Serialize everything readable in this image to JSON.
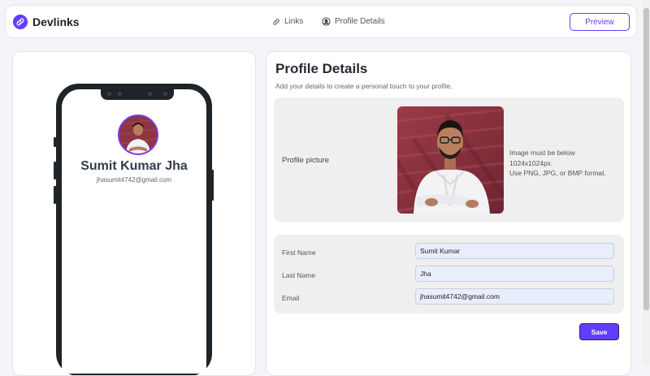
{
  "header": {
    "brand": "Devlinks",
    "tabs": [
      {
        "label": "Links",
        "icon": "link-icon"
      },
      {
        "label": "Profile Details",
        "icon": "user-circle-icon"
      }
    ],
    "preview_label": "Preview"
  },
  "preview": {
    "name": "Sumit Kumar Jha",
    "email": "jhasumit4742@gmail.com"
  },
  "profile": {
    "title": "Profile Details",
    "subtitle": "Add your details to create a personal touch to your profile.",
    "picture_label": "Profile picture",
    "picture_note": "Image must be below\n1024x1024px.\nUse PNG, JPG, or BMP format.",
    "fields": [
      {
        "label": "First Name",
        "value": "Sumit Kumar"
      },
      {
        "label": "Last Name",
        "value": "Jha"
      },
      {
        "label": "Email",
        "value": "jhasumit4742@gmail.com"
      }
    ],
    "save_label": "Save"
  },
  "colors": {
    "accent": "#633cff",
    "background": "#f5f4f8",
    "card": "#efefef",
    "input_fill": "#e8eefb"
  }
}
